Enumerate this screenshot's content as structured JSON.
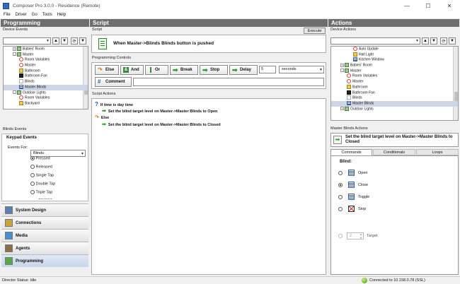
{
  "window": {
    "title": "Composer Pro 3.0.0 - Residence (Remote)",
    "min": "—",
    "max": "☐",
    "close": "✕"
  },
  "menu": [
    "File",
    "Driver",
    "Go",
    "Tools",
    "Help"
  ],
  "programming": {
    "header": "Programming",
    "device_events_label": "Device Events",
    "tree": [
      {
        "label": "Babies' Room",
        "indent": 1,
        "exp": "+",
        "icon": "room"
      },
      {
        "label": "Master",
        "indent": 1,
        "exp": "-",
        "icon": "room"
      },
      {
        "label": "Room Variables",
        "indent": 2,
        "icon": "var"
      },
      {
        "label": "Master",
        "indent": 2,
        "icon": "var"
      },
      {
        "label": "Bathroom",
        "indent": 2,
        "icon": "light"
      },
      {
        "label": "Bathroom Fan",
        "indent": 2,
        "icon": "fan"
      },
      {
        "label": "Blinds",
        "indent": 2,
        "icon": "blank"
      },
      {
        "label": "Master Blinds",
        "indent": 2,
        "icon": "blinds",
        "selected": true
      },
      {
        "label": "Outdoor Lights",
        "indent": 1,
        "exp": "-",
        "icon": "room"
      },
      {
        "label": "Room Variables",
        "indent": 2,
        "icon": "var"
      },
      {
        "label": "Backyard",
        "indent": 2,
        "icon": "light"
      }
    ],
    "blinds_events_label": "Blinds Events",
    "keypad_events_label": "Keypad Events",
    "events_for_label": "Events For:",
    "events_for_value": "Blinds",
    "radios": [
      {
        "label": "Pressed",
        "on": true
      },
      {
        "label": "Released",
        "on": false
      },
      {
        "label": "Single Tap",
        "on": false
      },
      {
        "label": "Double Tap",
        "on": false
      },
      {
        "label": "Triple Tap",
        "on": false
      }
    ],
    "nav": [
      {
        "label": "System Design",
        "color": "#5a7fb5"
      },
      {
        "label": "Connections",
        "color": "#c9a43b"
      },
      {
        "label": "Media",
        "color": "#4a8fd0"
      },
      {
        "label": "Agents",
        "color": "#8a6f4a"
      },
      {
        "label": "Programming",
        "color": "#58a848",
        "active": true
      }
    ]
  },
  "script": {
    "header": "Script",
    "script_label": "Script",
    "execute_label": "Execute",
    "when_text": "When Master->Blinds Blinds button is pushed",
    "programming_controls_label": "Programming Controls",
    "buttons": {
      "else": "Else",
      "and": "And",
      "or": "Or",
      "break": "Break",
      "stop": "Stop",
      "delay": "Delay",
      "comment": "Comment"
    },
    "delay_value": "5",
    "delay_unit": "seconds",
    "script_actions_label": "Script Actions",
    "actions": [
      {
        "text": "If time is day time",
        "indent": 0,
        "icon": "question"
      },
      {
        "text": "Set the blind target level on Master->Master Blinds to Open",
        "indent": 1,
        "icon": "arrow"
      },
      {
        "text": "Else",
        "indent": 0,
        "icon": "else"
      },
      {
        "text": "Set the blind target level on Master->Master Blinds to Closed",
        "indent": 1,
        "icon": "arrow"
      }
    ]
  },
  "actions": {
    "header": "Actions",
    "device_actions_label": "Device Actions",
    "tree": [
      {
        "label": "Auto Update",
        "indent": 3,
        "icon": "var"
      },
      {
        "label": "Hall Light",
        "indent": 3,
        "icon": "light"
      },
      {
        "label": "Kitchen Window",
        "indent": 3,
        "icon": "blinds"
      },
      {
        "label": "Babies' Room",
        "indent": 1,
        "exp": "+",
        "icon": "room"
      },
      {
        "label": "Master",
        "indent": 1,
        "exp": "-",
        "icon": "room"
      },
      {
        "label": "Room Variables",
        "indent": 2,
        "icon": "var"
      },
      {
        "label": "Master",
        "indent": 2,
        "icon": "var"
      },
      {
        "label": "Bathroom",
        "indent": 2,
        "icon": "light"
      },
      {
        "label": "Bathroom Fan",
        "indent": 2,
        "icon": "fan"
      },
      {
        "label": "Blinds",
        "indent": 2,
        "icon": "blank"
      },
      {
        "label": "Master Blinds",
        "indent": 2,
        "icon": "blinds",
        "selected": true
      },
      {
        "label": "Outdoor Lights",
        "indent": 1,
        "exp": "+",
        "icon": "room"
      }
    ],
    "mb_actions_label": "Master Blinds Actions",
    "preview_text": "Set the blind target level on Master->Master Blinds to Closed",
    "tabs": [
      "Commands",
      "Conditionals",
      "Loops"
    ],
    "blind_label": "Blind:",
    "options": [
      {
        "label": "Open",
        "on": false
      },
      {
        "label": "Close",
        "on": true
      },
      {
        "label": "Toggle",
        "on": false
      },
      {
        "label": "Stop",
        "on": false
      }
    ],
    "target_value": "2",
    "target_label": "Target"
  },
  "status": {
    "left": "Director Status: Idle",
    "right": "Connected to 10.158.0.78 (SSL)"
  }
}
